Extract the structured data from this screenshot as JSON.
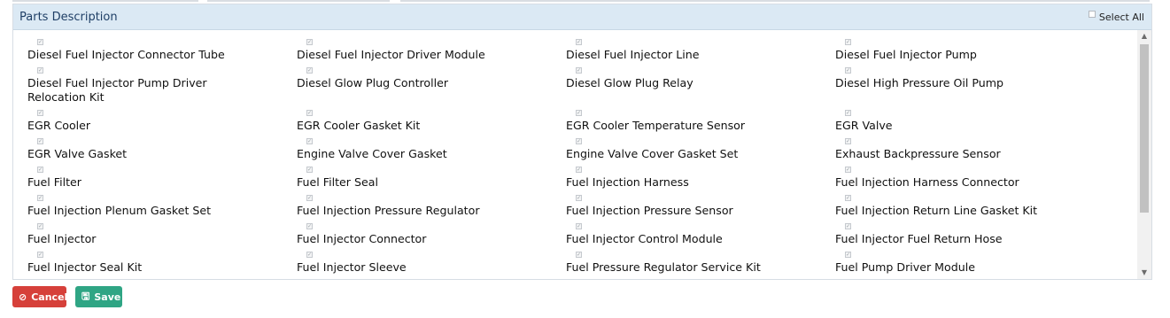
{
  "panel": {
    "title": "Parts Description",
    "select_all_label": "Select All"
  },
  "parts": [
    "Diesel Fuel Injector Connector Tube",
    "Diesel Fuel Injector Driver Module",
    "Diesel Fuel Injector Line",
    "Diesel Fuel Injector Pump",
    "Diesel Fuel Injector Pump Driver Relocation Kit",
    "Diesel Glow Plug Controller",
    "Diesel Glow Plug Relay",
    "Diesel High Pressure Oil Pump",
    "EGR Cooler",
    "EGR Cooler Gasket Kit",
    "EGR Cooler Temperature Sensor",
    "EGR Valve",
    "EGR Valve Gasket",
    "Engine Valve Cover Gasket",
    "Engine Valve Cover Gasket Set",
    "Exhaust Backpressure Sensor",
    "Fuel Filter",
    "Fuel Filter Seal",
    "Fuel Injection Harness",
    "Fuel Injection Harness Connector",
    "Fuel Injection Plenum Gasket Set",
    "Fuel Injection Pressure Regulator",
    "Fuel Injection Pressure Sensor",
    "Fuel Injection Return Line Gasket Kit",
    "Fuel Injector",
    "Fuel Injector Connector",
    "Fuel Injector Control Module",
    "Fuel Injector Fuel Return Hose",
    "Fuel Injector Seal Kit",
    "Fuel Injector Sleeve",
    "Fuel Pressure Regulator Service Kit",
    "Fuel Pump Driver Module"
  ],
  "buttons": {
    "cancel_label": "Cancel",
    "save_label": "Save",
    "cancel_icon": "ban-icon",
    "save_icon": "floppy-disk-icon",
    "cancel_color": "#d6403a",
    "save_color": "#2fa584"
  },
  "colors": {
    "header_bg": "#dbe9f4",
    "header_text": "#1f3f66"
  }
}
